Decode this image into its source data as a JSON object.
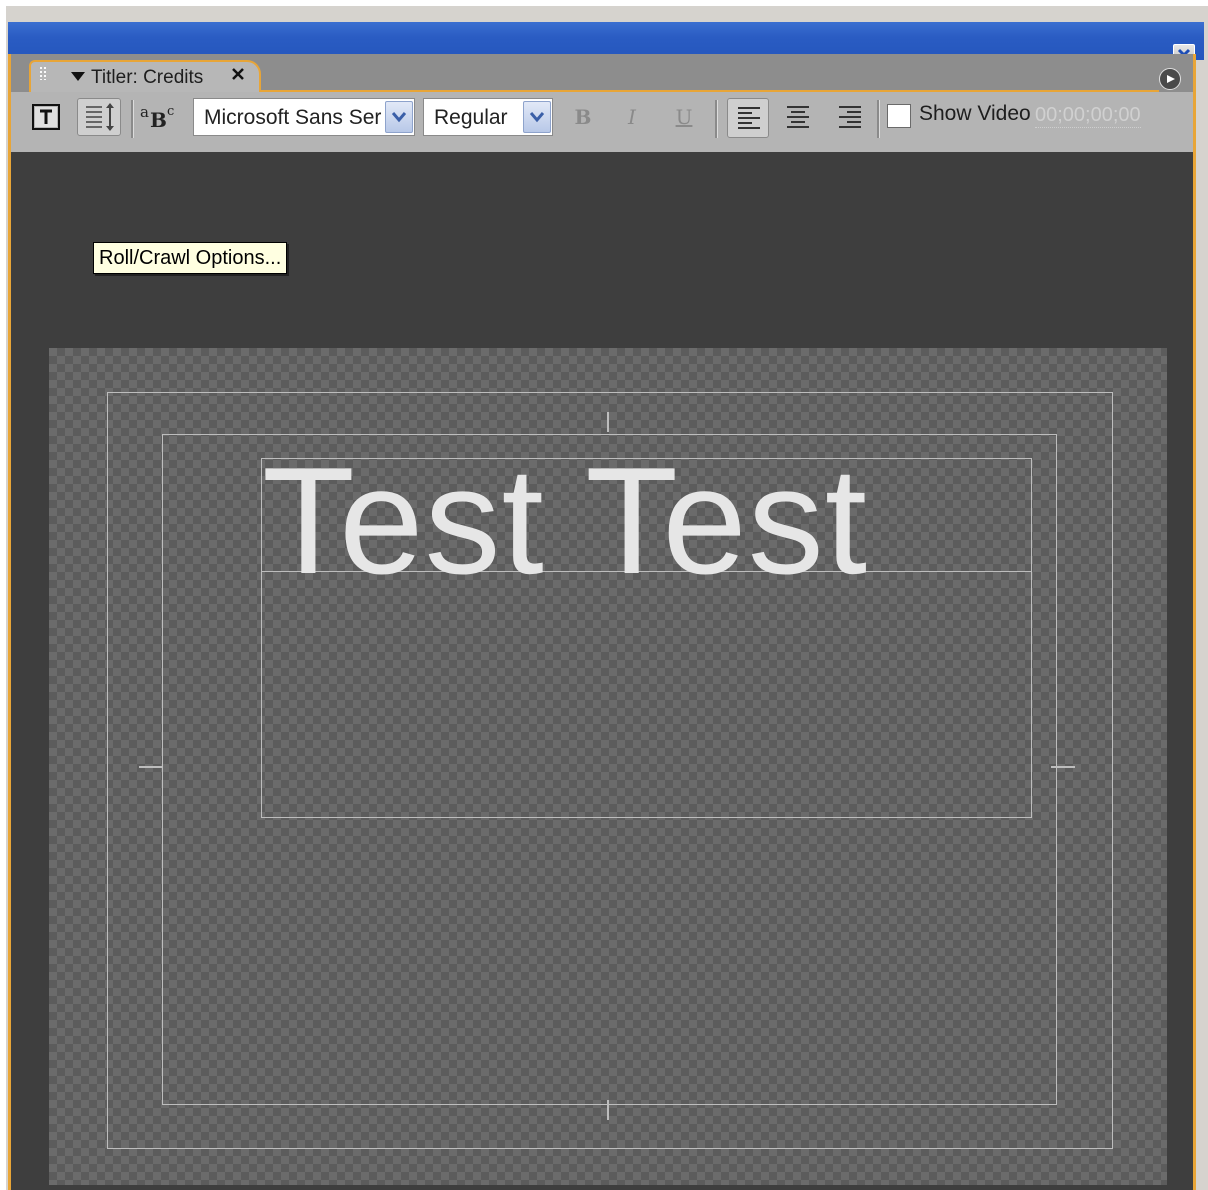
{
  "window": {
    "close_icon": "close-icon"
  },
  "panel": {
    "tab_label": "Titler: Credits",
    "menu_icon": "panel-menu-icon"
  },
  "toolbar": {
    "tooltip": "Roll/Crawl Options...",
    "font_family": "Microsoft Sans Serif",
    "font_style": "Regular",
    "bold_label": "B",
    "italic_label": "I",
    "underline_label": "U",
    "show_video_label": "Show Video",
    "timecode": "00;00;00;00"
  },
  "canvas": {
    "title_text": "Test Test"
  },
  "colors": {
    "panel_border": "#e8a537",
    "workarea_bg": "#3e3e3e",
    "title_bar": "#2a5cc3"
  }
}
